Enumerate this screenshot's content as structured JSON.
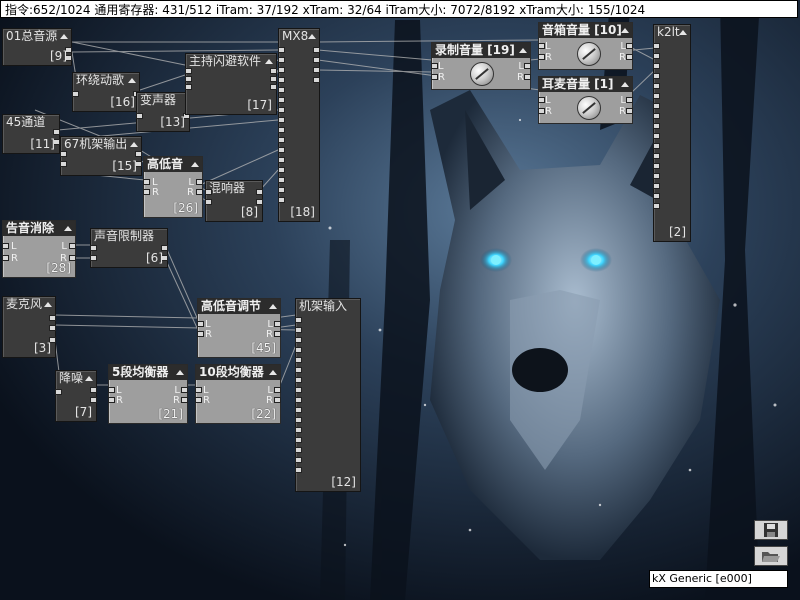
{
  "status_bar": "指令:652/1024 通用寄存器: 431/512 iTram: 37/192 xTram: 32/64 iTram大小: 7072/8192 xTram大小: 155/1024",
  "modules": [
    {
      "key": "m9",
      "title": "01总音源",
      "id": "[9]"
    },
    {
      "key": "m16",
      "title": "环绕动歌",
      "id": "[16]"
    },
    {
      "key": "m13",
      "title": "变声器",
      "id": "[13]"
    },
    {
      "key": "m17",
      "title": "主持闪避软件",
      "id": "[17]"
    },
    {
      "key": "m18",
      "title": "MX8",
      "id": "[18]"
    },
    {
      "key": "m11",
      "title": "45通道",
      "id": "[11]"
    },
    {
      "key": "m15",
      "title": "67机架输出",
      "id": "[15]"
    },
    {
      "key": "m26",
      "title": "高低音",
      "id": "[26]"
    },
    {
      "key": "m8",
      "title": "混响器",
      "id": "[8]"
    },
    {
      "key": "m19",
      "title": "录制音量 [19]",
      "id": ""
    },
    {
      "key": "m10",
      "title": "音箱音量 [10]",
      "id": ""
    },
    {
      "key": "m1",
      "title": "耳麦音量 [1]",
      "id": ""
    },
    {
      "key": "m2",
      "title": "k2lt",
      "id": "[2]"
    },
    {
      "key": "m28",
      "title": "告音消除",
      "id": "[28]"
    },
    {
      "key": "m6",
      "title": "声音限制器",
      "id": "[6]"
    },
    {
      "key": "m3",
      "title": "麦克风",
      "id": "[3]"
    },
    {
      "key": "m45",
      "title": "高低音调节",
      "id": "[45]"
    },
    {
      "key": "m12",
      "title": "机架输入",
      "id": "[12]"
    },
    {
      "key": "m7",
      "title": "降噪",
      "id": "[7]"
    },
    {
      "key": "m21",
      "title": "5段均衡器",
      "id": "[21]"
    },
    {
      "key": "m22",
      "title": "10段均衡器",
      "id": "[22]"
    }
  ],
  "port_labels": {
    "left": "L",
    "right": "R"
  },
  "icons": {
    "save": "save-icon",
    "open": "folder-open-icon",
    "collapse": "triangle-up-icon",
    "knob": "volume-knob-icon"
  },
  "device_select": "kX Generic [e000]",
  "colors": {
    "module_dark": "#3b3b3b",
    "module_light": "#9e9e9e",
    "wire": "#b8b8b8",
    "eye": "#3fd6ff"
  }
}
